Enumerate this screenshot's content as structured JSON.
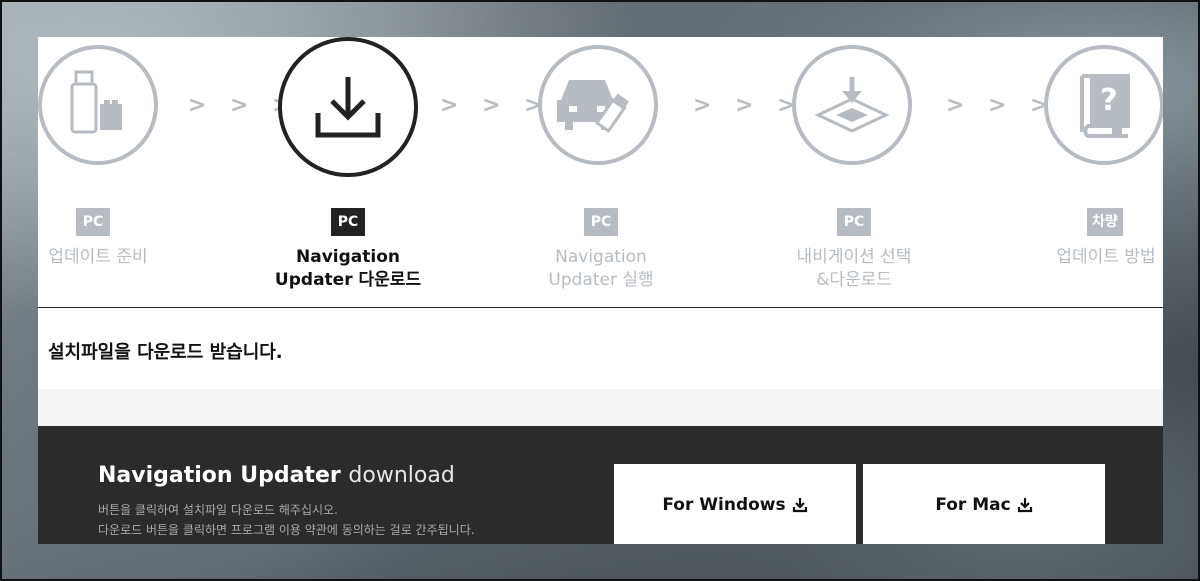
{
  "steps": [
    {
      "badge": "PC",
      "label": "업데이트 준비",
      "icon": "usb-sd-card-icon",
      "active": false
    },
    {
      "badge": "PC",
      "label": "Navigation\nUpdater 다운로드",
      "icon": "download-icon",
      "active": true
    },
    {
      "badge": "PC",
      "label": "Navigation\nUpdater 실행",
      "icon": "car-usb-icon",
      "active": false
    },
    {
      "badge": "PC",
      "label": "내비게이션 선택\n&다운로드",
      "icon": "download-to-tray-icon",
      "active": false
    },
    {
      "badge": "차량",
      "label": "업데이트 방법",
      "icon": "help-book-icon",
      "active": false
    }
  ],
  "separator": "> > >",
  "instruction": "설치파일을 다운로드 받습니다.",
  "download": {
    "title_bold": "Navigation Updater",
    "title_light": "download",
    "desc_line1": "버튼을 클릭하여 설치파일 다운로드 해주십시오.",
    "desc_line2": "다운로드 버튼을 클릭하면 프로그램 이용 약관에 동의하는 걸로 간주됩니다.",
    "windows_label": "For Windows",
    "mac_label": "For Mac"
  },
  "colors": {
    "active": "#222222",
    "inactive": "#b6bcc1",
    "dark_band": "#2b2b2b"
  }
}
